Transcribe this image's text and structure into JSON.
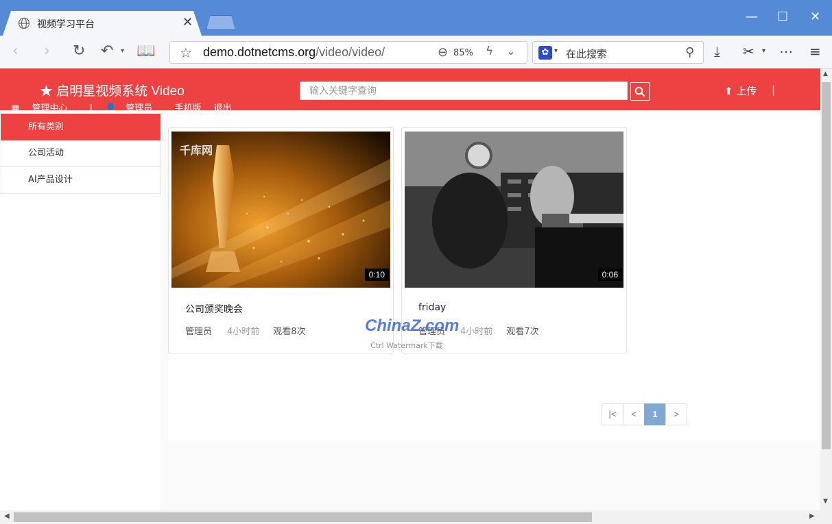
{
  "browser": {
    "tab_title": "视频学习平台",
    "url_host": "demo.dotnetcms.org",
    "url_path": "/video/video/",
    "zoom": "85%",
    "search_placeholder": "在此搜索",
    "window_minimize": "—",
    "window_maximize": "☐",
    "window_close": "✕",
    "tab_close": "✕"
  },
  "site": {
    "brand": "★ 启明星视频系统 Video",
    "search_placeholder": "输入关键字查询",
    "upload_label": "上传",
    "upload_sep": "|",
    "sublinks": {
      "admin_center": "管理中心",
      "sep": "|",
      "user": "管理员",
      "mobile": "手机版",
      "logout": "退出"
    }
  },
  "sidebar": {
    "items": [
      {
        "label": "所有类别",
        "active": true
      },
      {
        "label": "公司活动",
        "active": false
      },
      {
        "label": "AI产品设计",
        "active": false
      }
    ]
  },
  "videos": [
    {
      "title": "公司颁奖晚会",
      "author": "管理员",
      "time": "4小时前",
      "views": "观看8次",
      "duration": "0:10",
      "thumb_text": "千库网"
    },
    {
      "title": "friday",
      "author": "管理员",
      "time": "4小时前",
      "views": "观看7次",
      "duration": "0:06"
    }
  ],
  "pagination": {
    "first": "|<",
    "prev": "<",
    "current": "1",
    "next": ">"
  },
  "watermark": {
    "main": "ChinaZ.com",
    "sub": "Ctrl Watermark下载"
  },
  "colors": {
    "header_red": "#ee4141",
    "tabbar_blue": "#558bd6",
    "pager_active": "#7fa8d4"
  }
}
